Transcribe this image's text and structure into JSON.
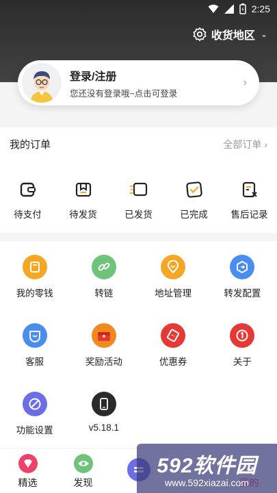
{
  "status": {
    "time": "2:25"
  },
  "region": {
    "label": "收货地区"
  },
  "login": {
    "title": "登录/注册",
    "subtitle": "您还没有登录哦~点击可登录"
  },
  "orders": {
    "title": "我的订单",
    "all_label": "全部订单",
    "items": [
      {
        "label": "待支付",
        "icon": "wallet-icon"
      },
      {
        "label": "待发货",
        "icon": "package-icon"
      },
      {
        "label": "已发货",
        "icon": "truck-icon"
      },
      {
        "label": "已完成",
        "icon": "check-box-icon"
      },
      {
        "label": "售后记录",
        "icon": "after-sale-icon"
      }
    ]
  },
  "tools": {
    "items": [
      {
        "label": "我的零钱",
        "color": "#f5a623",
        "icon": "wallet-icon"
      },
      {
        "label": "转链",
        "color": "#6ec27a",
        "icon": "link-icon"
      },
      {
        "label": "地址管理",
        "color": "#f5a623",
        "icon": "location-icon"
      },
      {
        "label": "转发配置",
        "color": "#4a8df0",
        "icon": "share-icon"
      },
      {
        "label": "客服",
        "color": "#4a8df0",
        "icon": "service-icon"
      },
      {
        "label": "奖励活动",
        "color": "#f08a1e",
        "icon": "gift-icon"
      },
      {
        "label": "优惠券",
        "color": "#e53935",
        "icon": "coupon-icon"
      },
      {
        "label": "关于",
        "color": "#e53935",
        "icon": "info-icon"
      },
      {
        "label": "功能设置",
        "color": "#6c6ee8",
        "icon": "settings-icon"
      },
      {
        "label": "v5.18.1",
        "color": "#2b2b2b",
        "icon": "phone-icon"
      }
    ]
  },
  "tabs": [
    {
      "label": "精选",
      "color": "#f0406b",
      "icon": "diamond-icon"
    },
    {
      "label": "发现",
      "color": "#6ec27a",
      "icon": "eye-icon"
    },
    {
      "label": "",
      "color": "#6c6ee8",
      "icon": "center-icon"
    },
    {
      "label": "",
      "color": "",
      "icon": ""
    },
    {
      "label": "我的",
      "color": "",
      "icon": ""
    }
  ],
  "watermark": {
    "main": "592软件园",
    "sub": "www.592xiazai.com"
  }
}
